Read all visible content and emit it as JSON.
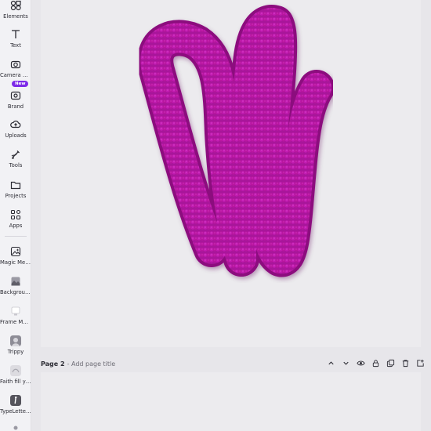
{
  "sidebar": {
    "items": [
      {
        "label": "Elements",
        "icon": "elements-icon"
      },
      {
        "label": "Text",
        "icon": "text-icon"
      },
      {
        "label": "Camera Roll",
        "icon": "camera-icon"
      },
      {
        "label": "Brand",
        "icon": "brand-icon",
        "badge": "New"
      },
      {
        "label": "Uploads",
        "icon": "upload-cloud-icon"
      },
      {
        "label": "Tools",
        "icon": "tools-icon"
      },
      {
        "label": "Projects",
        "icon": "folder-icon"
      },
      {
        "label": "Apps",
        "icon": "apps-icon"
      },
      {
        "label": "Magic Media",
        "icon": "magic-media-icon"
      },
      {
        "label": "Background",
        "icon": "background-icon"
      },
      {
        "label": "Frame Maker",
        "icon": "frame-maker-icon"
      },
      {
        "label": "Trippy",
        "icon": "trippy-icon"
      },
      {
        "label": "Faith fill yo...",
        "icon": "faith-fill-icon"
      },
      {
        "label": "TypeLetteri...",
        "icon": "type-lettering-icon"
      }
    ]
  },
  "page2": {
    "title": "Page 2",
    "subtitle": "- Add page title"
  },
  "colors": {
    "accent": "#7d2ae8",
    "letter": "#b0139e"
  }
}
